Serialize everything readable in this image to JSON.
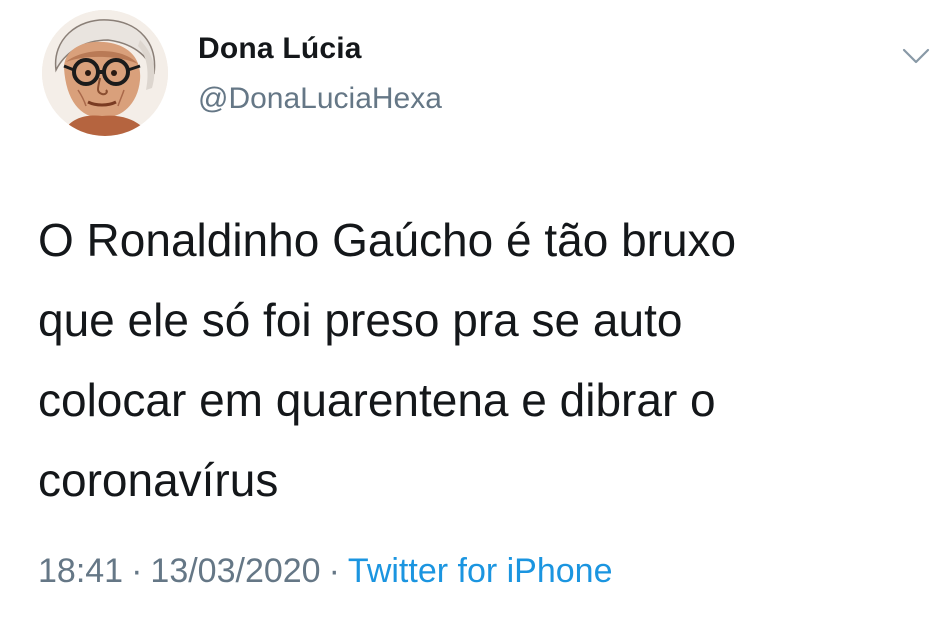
{
  "author": {
    "display_name": "Dona Lúcia",
    "handle": "@DonaLuciaHexa",
    "avatar_icon": "cartoon-grandma-avatar"
  },
  "menu": {
    "icon": "chevron-down-icon"
  },
  "tweet": {
    "text": "O Ronaldinho Gaúcho é tão bruxo\nque ele só foi preso pra se auto\ncolocar em quarentena e dibrar o\ncoronavírus"
  },
  "meta": {
    "time": "18:41",
    "date": "13/03/2020",
    "separator": "·",
    "source": "Twitter for iPhone"
  },
  "colors": {
    "text": "#14171a",
    "secondary": "#657786",
    "link": "#1b95e0",
    "background": "#ffffff"
  }
}
